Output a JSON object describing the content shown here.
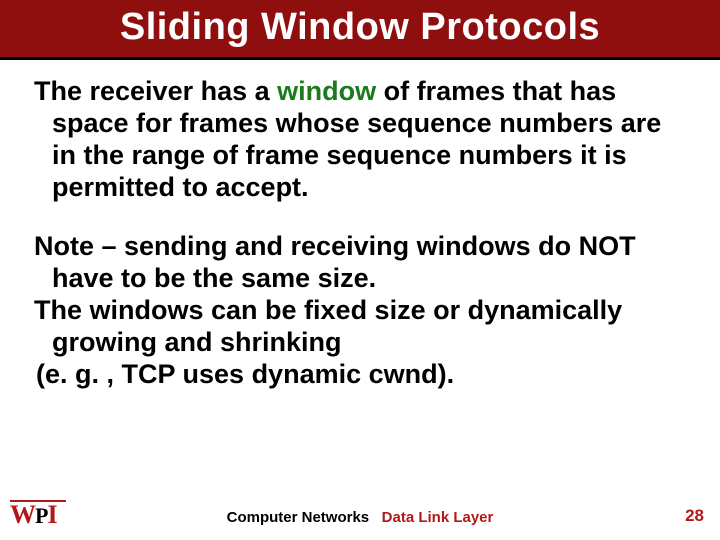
{
  "title": "Sliding Window Protocols",
  "para1": {
    "t1": "The receiver has a ",
    "kw": "window",
    "t2": " of frames that has space for frames whose sequence numbers are in the range of frame sequence numbers it is permitted to accept."
  },
  "para2": "Note – sending and receiving windows do NOT have to be the same size.",
  "para3": "The windows can be fixed size or dynamically growing and shrinking",
  "para4": " (e. g. , TCP uses dynamic cwnd).",
  "footer": {
    "course": "Computer Networks",
    "topic": "Data Link Layer",
    "page": "28",
    "logo_w": "W",
    "logo_p": "P",
    "logo_i": "I"
  }
}
